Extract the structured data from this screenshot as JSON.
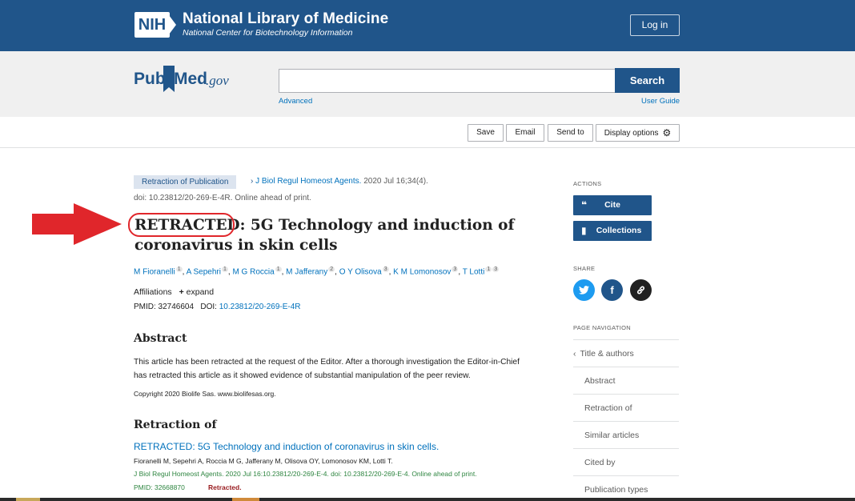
{
  "header": {
    "logo_text": "NIH",
    "org_title": "National Library of Medicine",
    "org_subtitle": "National Center for Biotechnology Information",
    "login_label": "Log in"
  },
  "search": {
    "logo_pub": "Pub",
    "logo_med": "Med",
    "logo_gov": ".gov",
    "input_value": "",
    "button_label": "Search",
    "advanced_label": "Advanced",
    "user_guide_label": "User Guide"
  },
  "toolbar": {
    "save_label": "Save",
    "email_label": "Email",
    "send_to_label": "Send to",
    "display_options_label": "Display options"
  },
  "article": {
    "badge": "Retraction of Publication",
    "journal": "J Biol Regul Homeost Agents.",
    "date_vol": "2020 Jul 16;34(4).",
    "doi_line": "doi: 10.23812/20-269-E-4R. Online ahead of print.",
    "title_retracted": "RETRACTED:",
    "title_line1_rest": " 5G Technology and induction of",
    "title_line2": "coronavirus in skin cells",
    "authors": [
      {
        "name": "M Fioranelli",
        "aff": "1"
      },
      {
        "name": "A Sepehri",
        "aff": "1"
      },
      {
        "name": "M G Roccia",
        "aff": "1"
      },
      {
        "name": "M Jafferany",
        "aff": "2"
      },
      {
        "name": "O Y Olisova",
        "aff": "3"
      },
      {
        "name": "K M Lomonosov",
        "aff": "3"
      },
      {
        "name": "T Lotti",
        "aff": "1",
        "aff2": "3"
      }
    ],
    "affiliations_label": "Affiliations",
    "expand_label": "expand",
    "pmid_label": "PMID: 32746604",
    "doi_label": "DOI:",
    "doi_value": "10.23812/20-269-E-4R"
  },
  "abstract": {
    "heading": "Abstract",
    "text": "This article has been retracted at the request of the Editor. After a thorough investigation the Editor-in-Chief has retracted this article as it showed evidence of substantial manipulation of the peer review.",
    "copyright": "Copyright 2020 Biolife Sas. www.biolifesas.org."
  },
  "retraction_of": {
    "heading": "Retraction of",
    "link": "RETRACTED: 5G Technology and induction of coronavirus in skin cells.",
    "authors": "Fioranelli M, Sepehri A, Roccia M G, Jafferany M, Olisova OY, Lomonosov KM, Lotti T.",
    "journal": "J Biol Regul Homeost Agents. 2020 Jul 16:10.23812/20-269-E-4. doi: 10.23812/20-269-E-4. Online ahead of print.",
    "pmid": "PMID: 32668870",
    "status": "Retracted."
  },
  "sidebar": {
    "actions_heading": "ACTIONS",
    "cite_label": "Cite",
    "collections_label": "Collections",
    "share_heading": "SHARE",
    "page_nav_heading": "PAGE NAVIGATION",
    "nav_items": [
      "Title & authors",
      "Abstract",
      "Retraction of",
      "Similar articles",
      "Cited by",
      "Publication types"
    ]
  },
  "colors": {
    "nih_blue": "#20558a",
    "link_blue": "#0071bc",
    "annotation_red": "#e0262b",
    "twitter": "#1d9bf0",
    "facebook": "#20558a",
    "permalink": "#212121"
  }
}
